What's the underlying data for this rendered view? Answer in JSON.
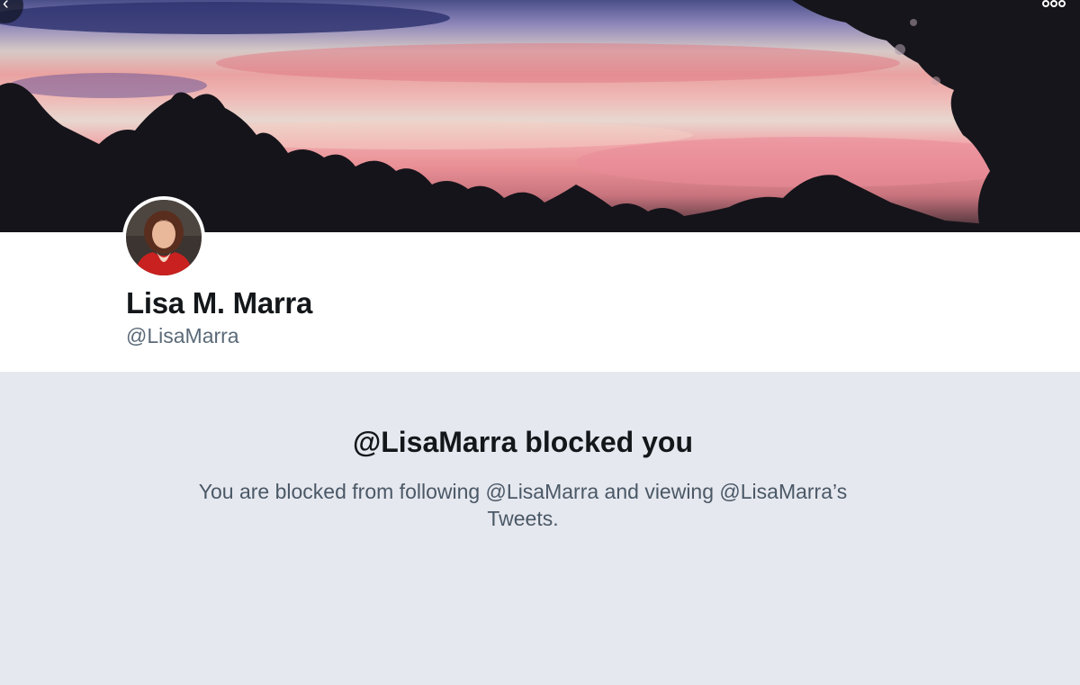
{
  "profile": {
    "display_name": "Lisa M. Marra",
    "handle": "@LisaMarra"
  },
  "nav": {
    "back_icon": "chevron-left-icon",
    "more_icon": "more-horizontal-icon"
  },
  "blocked": {
    "title": "@LisaMarra blocked you",
    "description": "You are blocked from following @LisaMarra and viewing @LisaMarra’s Tweets."
  },
  "colors": {
    "text_primary": "#14171a",
    "text_secondary": "#5b6a78",
    "page_background": "#e6e8ef"
  }
}
